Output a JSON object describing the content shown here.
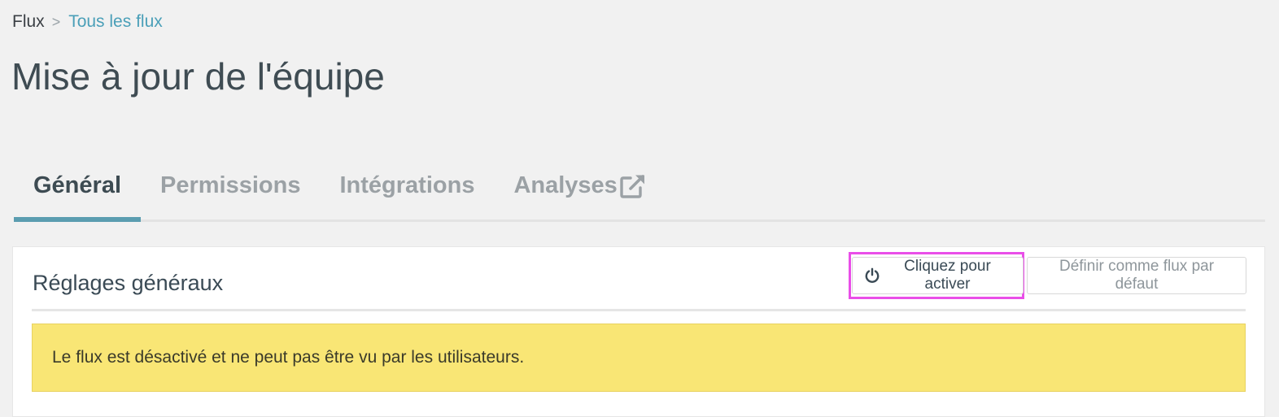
{
  "breadcrumb": {
    "root": "Flux",
    "separator": ">",
    "current": "Tous les flux"
  },
  "page": {
    "title": "Mise à jour de l'équipe"
  },
  "tabs": [
    {
      "label": "Général",
      "active": true
    },
    {
      "label": "Permissions",
      "active": false
    },
    {
      "label": "Intégrations",
      "active": false
    },
    {
      "label": "Analyses",
      "active": false,
      "icon": "external-link-icon"
    }
  ],
  "panel": {
    "title": "Réglages généraux",
    "activate_button": {
      "label": "Cliquez pour activer",
      "icon": "power-icon"
    },
    "default_button": {
      "label": "Définir comme flux par défaut"
    },
    "alert": {
      "text": "Le flux est désactivé et ne peut pas être vu par les utilisateurs."
    }
  },
  "colors": {
    "accent": "#5b9db0",
    "link": "#4a9fb8",
    "alert_bg": "#f9e675",
    "highlight": "#e94ee8"
  }
}
